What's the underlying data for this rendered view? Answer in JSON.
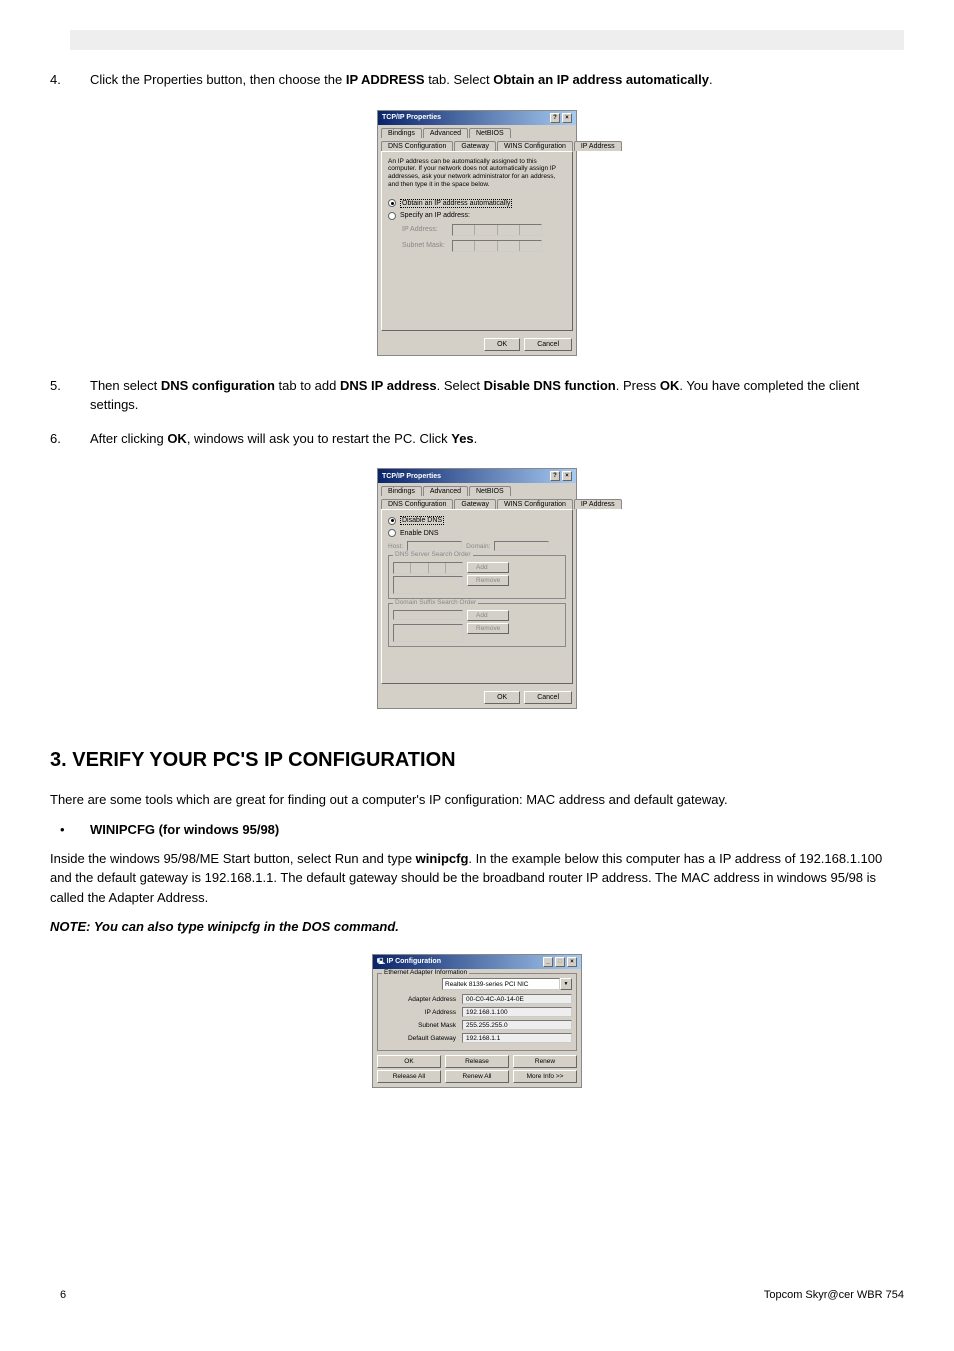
{
  "step4": {
    "num": "4.",
    "text_pre": "Click the Properties button, then choose the ",
    "text_bold1": "IP ADDRESS",
    "text_mid": " tab. Select ",
    "text_bold2": "Obtain an IP address automatically",
    "text_end": "."
  },
  "dialog1": {
    "title": "TCP/IP Properties",
    "tabs_row1": [
      "Bindings",
      "Advanced",
      "NetBIOS"
    ],
    "tabs_row2": [
      "DNS Configuration",
      "Gateway",
      "WINS Configuration",
      "IP Address"
    ],
    "info": "An IP address can be automatically assigned to this computer. If your network does not automatically assign IP addresses, ask your network administrator for an address, and then type it in the space below.",
    "opt_auto": "Obtain an IP address automatically",
    "opt_specify": "Specify an IP address:",
    "lbl_ip": "IP Address:",
    "lbl_mask": "Subnet Mask:",
    "ok": "OK",
    "cancel": "Cancel"
  },
  "step5": {
    "num": "5.",
    "pre": "Then select ",
    "b1": "DNS configuration",
    "m1": " tab to add ",
    "b2": "DNS IP address",
    "m2": ". Select ",
    "b3": "Disable DNS function",
    "m3": ". Press ",
    "b4": "OK",
    "end": ". You have completed the client settings."
  },
  "step6": {
    "num": "6.",
    "pre": "After clicking ",
    "b1": "OK",
    "m1": ", windows will ask you to restart the PC. Click ",
    "b2": "Yes",
    "end": "."
  },
  "dialog2": {
    "title": "TCP/IP Properties",
    "tabs_row1": [
      "Bindings",
      "Advanced",
      "NetBIOS"
    ],
    "tabs_row2": [
      "DNS Configuration",
      "Gateway",
      "WINS Configuration",
      "IP Address"
    ],
    "opt_disable": "Disable DNS",
    "opt_enable": "Enable DNS",
    "lbl_host": "Host:",
    "lbl_domain": "Domain:",
    "grp_search": "DNS Server Search Order",
    "grp_suffix": "Domain Suffix Search Order",
    "btn_add": "Add",
    "btn_remove": "Remove",
    "ok": "OK",
    "cancel": "Cancel"
  },
  "section3": {
    "heading": "3.  VERIFY YOUR PC'S IP CONFIGURATION",
    "intro": "There are some tools which are great for finding out a computer's IP configuration: MAC address and default gateway.",
    "bullet_label": "WINIPCFG (for windows 95/98)",
    "para": {
      "pre": "Inside the windows 95/98/ME Start button, select Run and type ",
      "b1": "winipcfg",
      "rest": ". In the example below this computer has a IP address of 192.168.1.100 and the default gateway is 192.168.1.1. The default gateway should be the broadband router IP address. The MAC address in windows 95/98 is called the Adapter Address."
    },
    "note": "NOTE: You can also type winipcfg in the DOS command."
  },
  "dialog3": {
    "title": "IP Configuration",
    "group": "Ethernet Adapter Information",
    "adapter": "Realtek 8139-series PCI NIC",
    "rows": [
      {
        "label": "Adapter Address",
        "value": "00-C0-4C-A0-14-0E"
      },
      {
        "label": "IP Address",
        "value": "192.168.1.100"
      },
      {
        "label": "Subnet Mask",
        "value": "255.255.255.0"
      },
      {
        "label": "Default Gateway",
        "value": "192.168.1.1"
      }
    ],
    "btns_row1": [
      "OK",
      "Release",
      "Renew"
    ],
    "btns_row2": [
      "Release All",
      "Renew All",
      "More Info >>"
    ]
  },
  "footer": {
    "page": "6",
    "product": "Topcom Skyr@cer WBR 754"
  }
}
